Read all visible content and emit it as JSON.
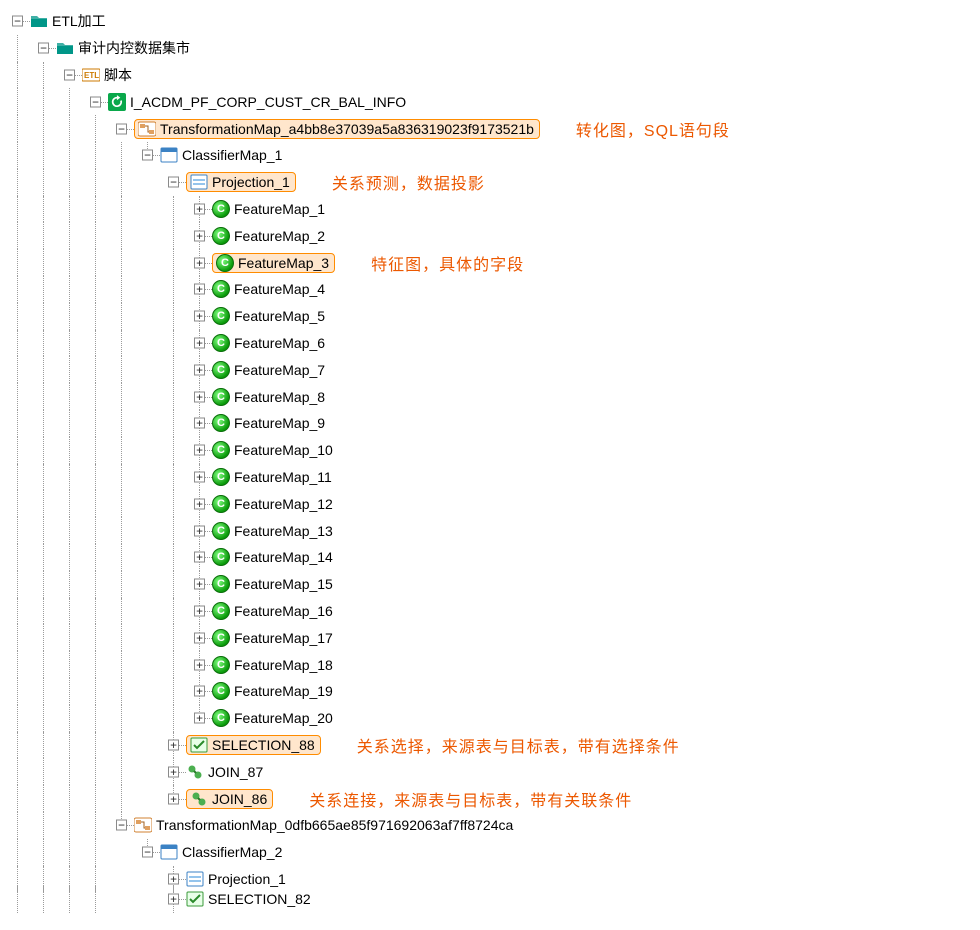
{
  "tree": {
    "root": {
      "label": "ETL加工"
    },
    "l1": {
      "label": "审计内控数据集市"
    },
    "l2": {
      "label": "脚本"
    },
    "l3": {
      "label": "I_ACDM_PF_CORP_CUST_CR_BAL_INFO"
    },
    "tmap1": {
      "label": "TransformationMap_a4bb8e37039a5a836319023f9173521b"
    },
    "cmap1": {
      "label": "ClassifierMap_1"
    },
    "proj1": {
      "label": "Projection_1"
    },
    "features": [
      {
        "label": "FeatureMap_1"
      },
      {
        "label": "FeatureMap_2"
      },
      {
        "label": "FeatureMap_3"
      },
      {
        "label": "FeatureMap_4"
      },
      {
        "label": "FeatureMap_5"
      },
      {
        "label": "FeatureMap_6"
      },
      {
        "label": "FeatureMap_7"
      },
      {
        "label": "FeatureMap_8"
      },
      {
        "label": "FeatureMap_9"
      },
      {
        "label": "FeatureMap_10"
      },
      {
        "label": "FeatureMap_11"
      },
      {
        "label": "FeatureMap_12"
      },
      {
        "label": "FeatureMap_13"
      },
      {
        "label": "FeatureMap_14"
      },
      {
        "label": "FeatureMap_15"
      },
      {
        "label": "FeatureMap_16"
      },
      {
        "label": "FeatureMap_17"
      },
      {
        "label": "FeatureMap_18"
      },
      {
        "label": "FeatureMap_19"
      },
      {
        "label": "FeatureMap_20"
      }
    ],
    "sel88": {
      "label": "SELECTION_88"
    },
    "join87": {
      "label": "JOIN_87"
    },
    "join86": {
      "label": "JOIN_86"
    },
    "tmap2": {
      "label": "TransformationMap_0dfb665ae85f971692063af7ff8724ca"
    },
    "cmap2": {
      "label": "ClassifierMap_2"
    },
    "proj2": {
      "label": "Projection_1"
    },
    "sel82": {
      "label": "SELECTION_82"
    }
  },
  "annotations": {
    "tmap": "转化图，SQL语句段",
    "proj": "关系预测，数据投影",
    "feat": "特征图，具体的字段",
    "sel": "关系选择，来源表与目标表，带有选择条件",
    "join": "关系连接，来源表与目标表，带有关联条件"
  },
  "glyph": {
    "plus": "+",
    "minus": "−",
    "c": "C"
  }
}
